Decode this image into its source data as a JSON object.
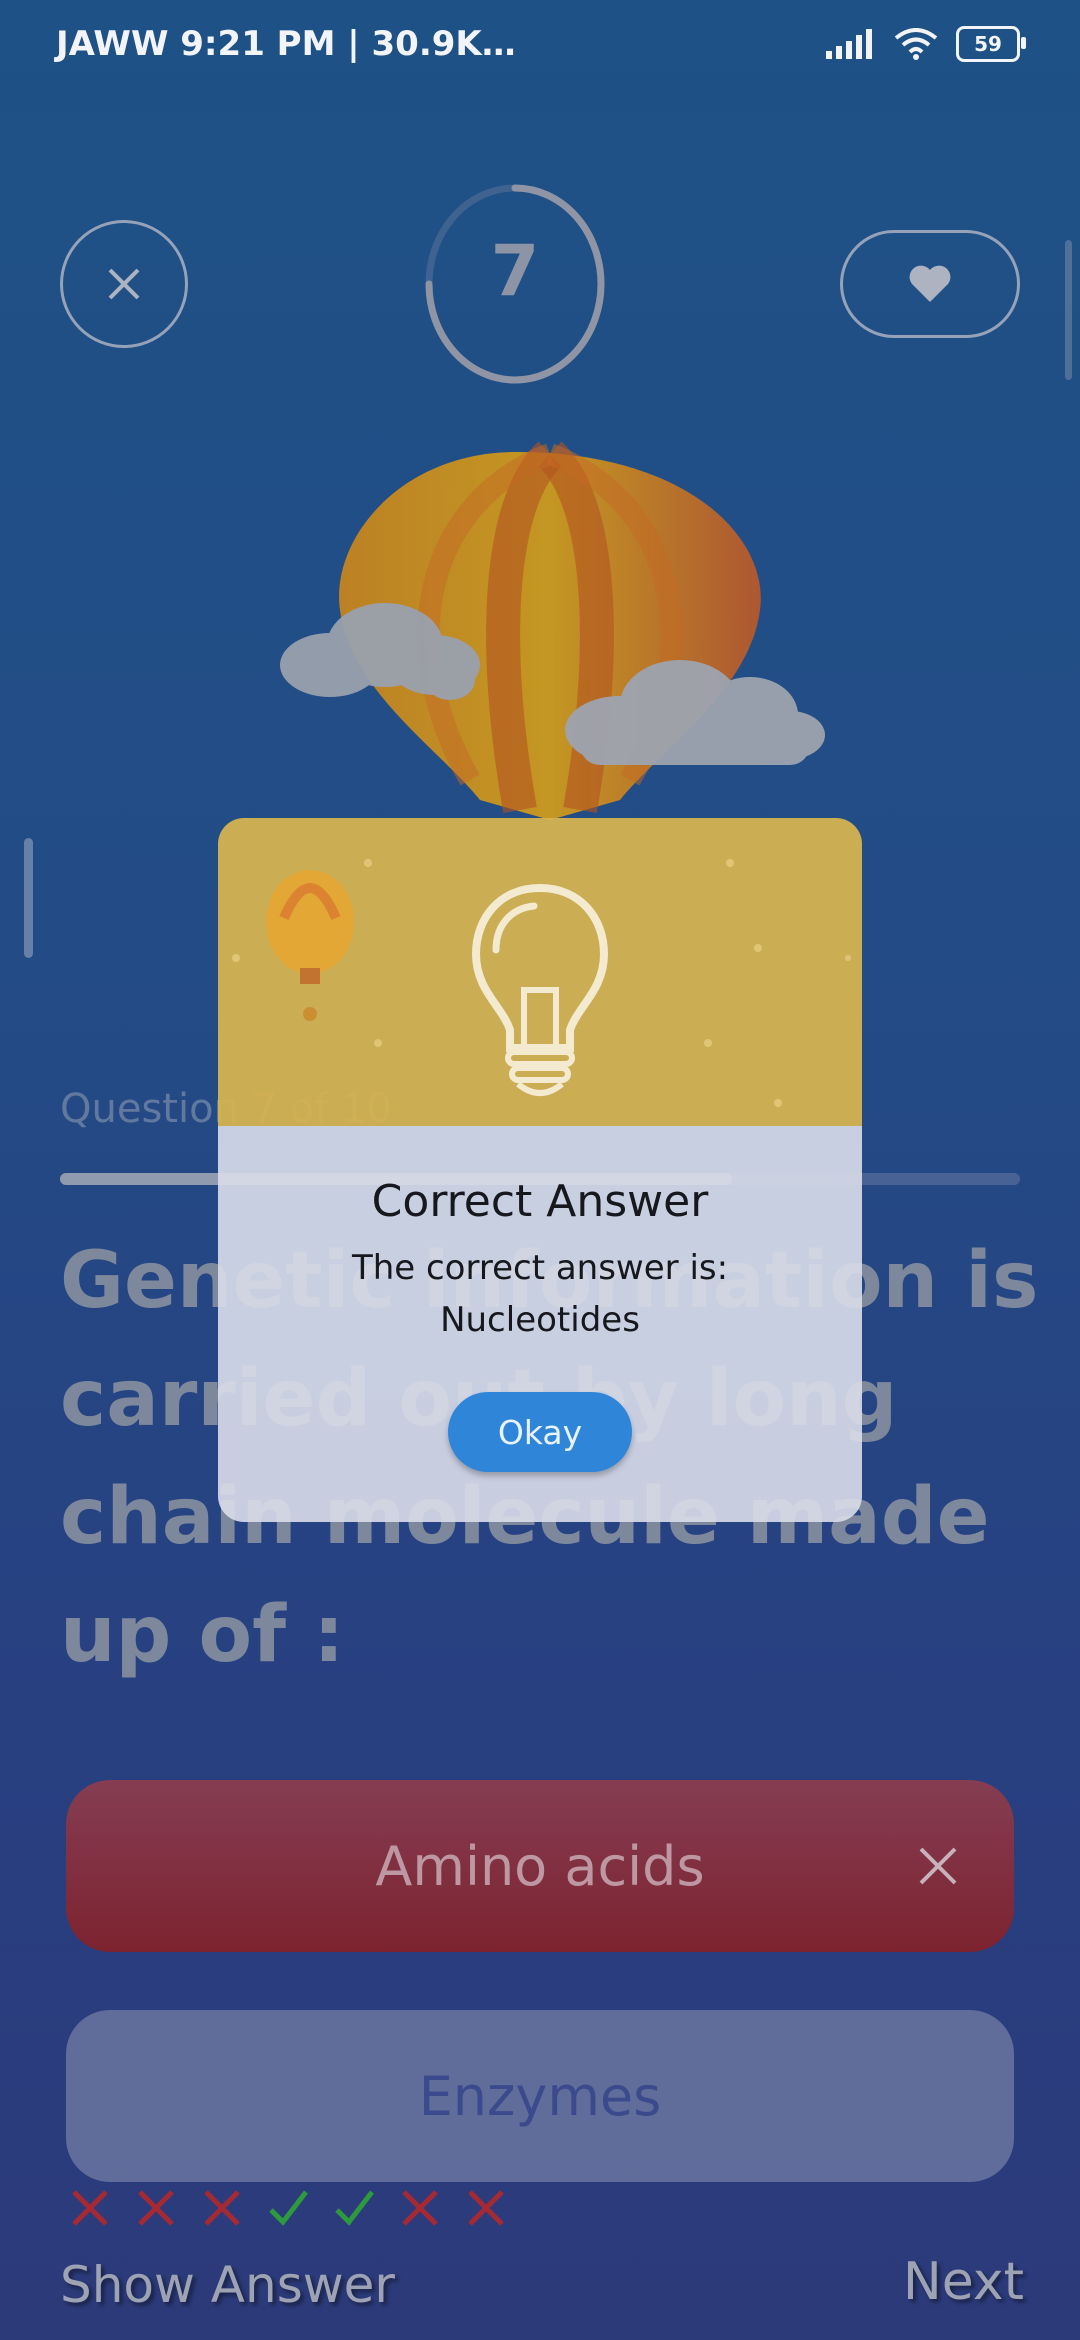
{
  "status_bar": {
    "left_text": "JAWW  9:21 PM | 30.9K…",
    "battery_level": "59"
  },
  "timer": {
    "value": "7",
    "fraction_remaining": 0.75
  },
  "question": {
    "label": "Question 7 of 10",
    "progress_fraction": 0.7,
    "text": "Genetic information is carried out by long chain molecule made up of :"
  },
  "options": [
    {
      "label": "Amino acids",
      "state": "wrong"
    },
    {
      "label": "Enzymes",
      "state": "neutral"
    }
  ],
  "answer_history": [
    "wrong",
    "wrong",
    "wrong",
    "correct",
    "correct",
    "wrong",
    "wrong"
  ],
  "footer": {
    "show_answer_label": "Show Answer",
    "next_label": "Next"
  },
  "dialog": {
    "title": "Correct Answer",
    "message_line1": "The correct answer is:",
    "message_line2": "Nucleotides",
    "okay_label": "Okay"
  },
  "colors": {
    "background_top": "#1e5186",
    "wrong_option": "#7d2330",
    "correct_mark": "#2e9a3e",
    "wrong_mark": "#a52a33",
    "dialog_header": "#d8b550",
    "okay_button": "#2f86d9"
  }
}
